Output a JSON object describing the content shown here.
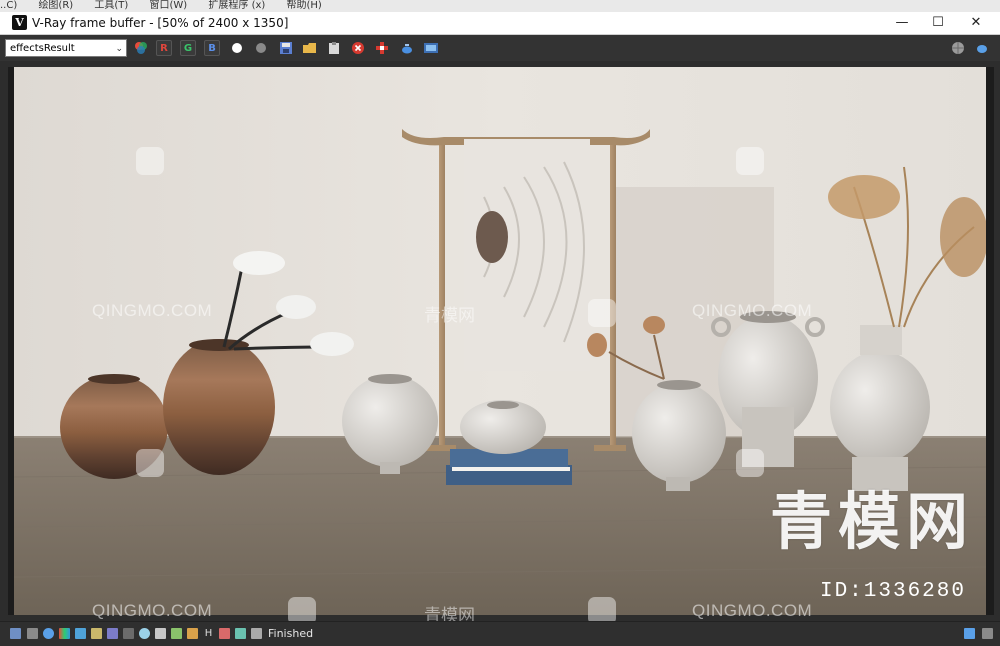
{
  "host_menu": [
    "..C)",
    "绘图(R)",
    "工具(T)",
    "窗口(W)",
    "扩展程序 (x)",
    "帮助(H)"
  ],
  "window": {
    "title": "V-Ray frame buffer - [50% of 2400 x 1350]",
    "logo_letter": "V",
    "controls": {
      "minimize": "—",
      "maximize": "☐",
      "close": "✕"
    }
  },
  "toolbar": {
    "channel": "effectsResult",
    "channel_arrow": "⌄",
    "r": "R",
    "g": "G",
    "b": "B",
    "icons": [
      "color-wheel-icon",
      "white-dot-icon",
      "gray-dot-icon",
      "save-icon",
      "open-folder-icon",
      "clipboard-icon",
      "stop-render-icon",
      "region-icon",
      "teapot-icon",
      "film-icon",
      "globe-icon",
      "teapot-small-icon"
    ]
  },
  "render": {
    "watermark_en": "QINGMO.COM",
    "watermark_cn": "青模网",
    "brand": "青模网",
    "id_label": "ID:1336280"
  },
  "statusbar": {
    "status": "Finished",
    "h_label": "H"
  },
  "colors": {
    "accent_red": "#c0392b",
    "accent_green": "#2ecc71",
    "accent_blue": "#2f6fd8"
  }
}
